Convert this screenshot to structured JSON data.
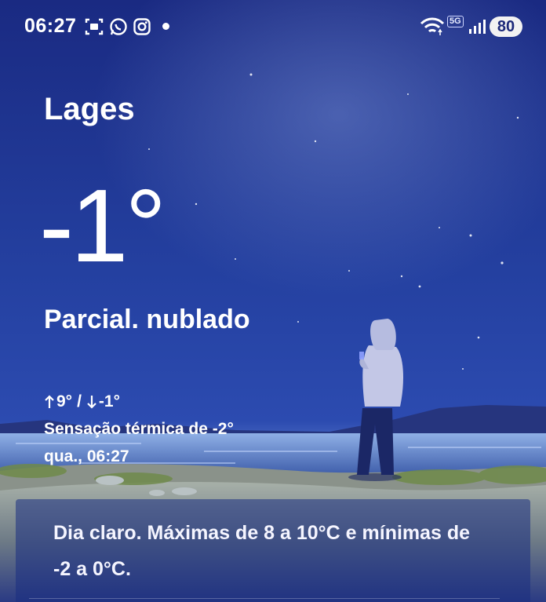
{
  "status_bar": {
    "time": "06:27",
    "network_label": "5G",
    "battery": "80",
    "icons": [
      "screenshot-icon",
      "whatsapp-icon",
      "instagram-icon",
      "notification-dot",
      "wifi-icon",
      "signal-icon"
    ]
  },
  "weather": {
    "city": "Lages",
    "temperature": "-1°",
    "condition": "Parcial. nublado",
    "high": "9°",
    "low": "-1°",
    "hilo_separator": "/",
    "feels_like": "Sensação térmica de -2°",
    "updated": "qua., 06:27"
  },
  "summary": {
    "text": "Dia claro. Máximas de 8 a 10°C e mínimas de -2 a 0°C."
  },
  "colors": {
    "sky_top": "#1b2b85",
    "sky_mid": "#2f48a6",
    "horizon": "#7f9fd8",
    "hill": "#7e8a86",
    "card": "#1e3282"
  }
}
